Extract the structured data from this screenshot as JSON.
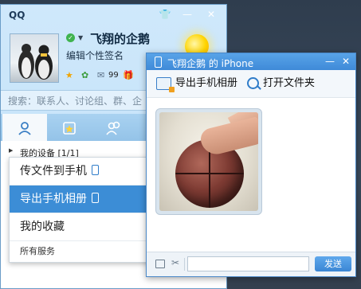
{
  "qq": {
    "title": "QQ",
    "nickname": "飞翔的企鹅",
    "signature": "编辑个性签名",
    "mail_count": "99",
    "search_placeholder": "搜索：联系人、讨论组、群、企",
    "group": {
      "label": "我的设备",
      "count": "[1/1]"
    },
    "menu_items": [
      "传文件到手机",
      "导出手机相册",
      "我的收藏"
    ],
    "menu_footer": "所有服务"
  },
  "chat": {
    "title": "飞翔企鹅 的 iPhone",
    "toolbar": {
      "export_label": "导出手机相册",
      "open_folder_label": "打开文件夹"
    },
    "send_label": "发送"
  },
  "colors": {
    "accent": "#3c8dd6",
    "titlebar": "#4a96e0"
  },
  "icons": [
    "shirt-icon",
    "minimize-icon",
    "close-icon",
    "status-online-icon",
    "sun-icon",
    "star-icon",
    "qzone-icon",
    "mail-icon",
    "gift-icon",
    "contacts-tab-icon",
    "favorites-tab-icon",
    "groups-tab-icon",
    "phone-icon",
    "export-icon",
    "search-icon",
    "folder-icon",
    "scissors-icon"
  ]
}
